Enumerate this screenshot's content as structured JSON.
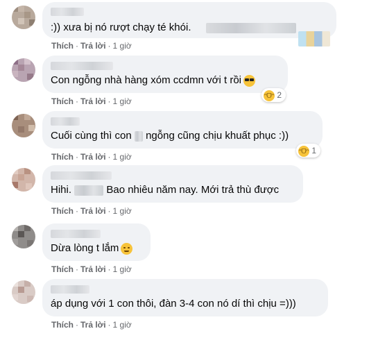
{
  "comments": [
    {
      "text": ":)) xưa bị nó rượt chạy té khói.",
      "action_like": "Thích",
      "action_reply": "Trả lời",
      "time": "1 giờ",
      "reaction_icon": "",
      "reaction_count": ""
    },
    {
      "text": "Con ngỗng nhà hàng xóm ccdmn với t rồi",
      "inline_emoji": "cool-face-emoji",
      "action_like": "Thích",
      "action_reply": "Trả lời",
      "time": "1 giờ",
      "reaction_icon": "laughing-emoji",
      "reaction_count": "2"
    },
    {
      "text_before": "Cuối cùng thì con",
      "text_after": "ngỗng cũng chịu khuất phục :))",
      "action_like": "Thích",
      "action_reply": "Trả lời",
      "time": "1 giờ",
      "reaction_icon": "laughing-emoji",
      "reaction_count": "1"
    },
    {
      "text_before": "Hihi.",
      "text_after": "Bao nhiêu năm nay. Mới trả thù được",
      "action_like": "Thích",
      "action_reply": "Trả lời",
      "time": "1 giờ",
      "reaction_icon": "",
      "reaction_count": ""
    },
    {
      "text": "Dừa lòng t lắm",
      "inline_emoji": "relieved-face-emoji",
      "action_like": "Thích",
      "action_reply": "Trả lời",
      "time": "1 giờ",
      "reaction_icon": "",
      "reaction_count": ""
    },
    {
      "text": "áp dụng với 1 con thôi, đàn 3-4 con nó dí thì chịu =)))",
      "action_like": "Thích",
      "action_reply": "Trả lời",
      "time": "1 giờ",
      "reaction_icon": "",
      "reaction_count": ""
    }
  ],
  "colors": {
    "bubble": "#f0f2f5",
    "meta_text": "#65676b",
    "body_text": "#050505"
  }
}
